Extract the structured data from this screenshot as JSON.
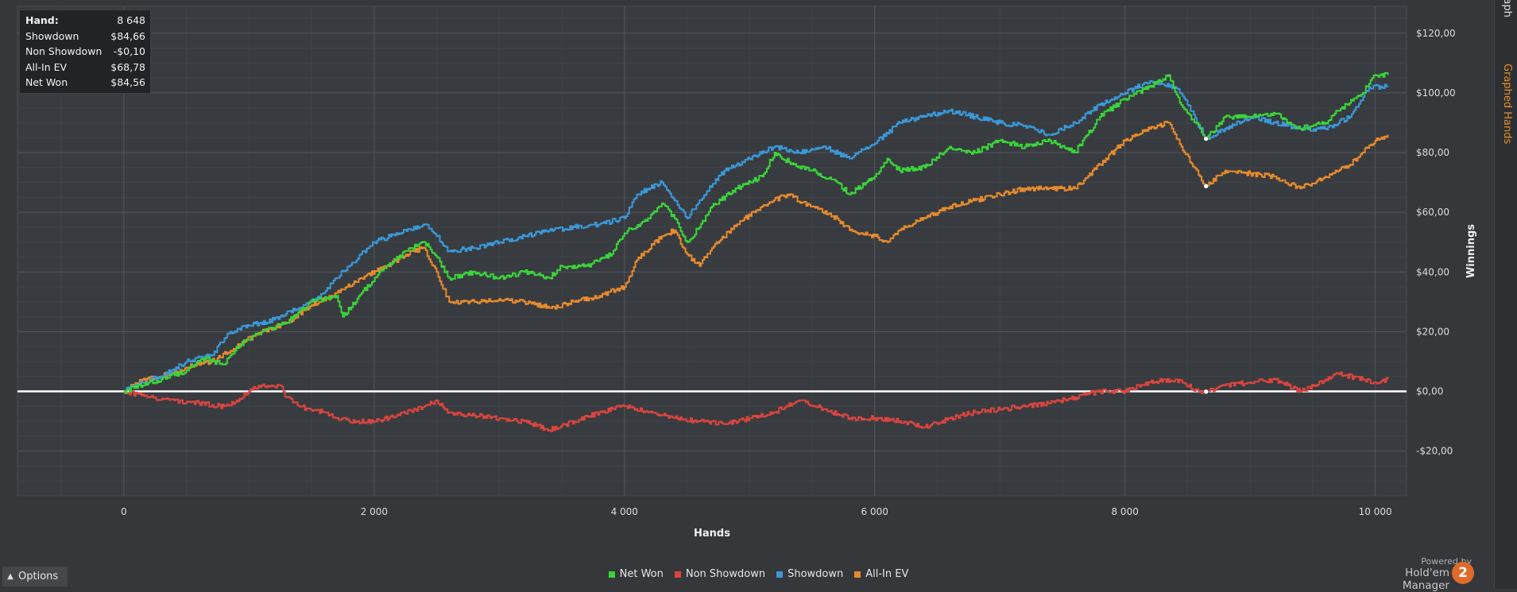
{
  "tooltip": {
    "rows": [
      {
        "label": "Hand:",
        "value": "8 648"
      },
      {
        "label": "Showdown",
        "value": "$84,66"
      },
      {
        "label": "Non Showdown",
        "value": "-$0,10"
      },
      {
        "label": "All-In EV",
        "value": "$68,78"
      },
      {
        "label": "Net Won",
        "value": "$84,56"
      }
    ]
  },
  "chart_data": {
    "type": "line",
    "xlabel": "Hands",
    "ylabel": "Winnings",
    "xlim": [
      -850,
      10250
    ],
    "ylim": [
      -35,
      129
    ],
    "x_ticks": [
      0,
      2000,
      4000,
      6000,
      8000,
      10000
    ],
    "x_tick_labels": [
      "0",
      "2 000",
      "4 000",
      "6 000",
      "8 000",
      "10 000"
    ],
    "y_ticks": [
      -20,
      0,
      20,
      40,
      60,
      80,
      100,
      120
    ],
    "y_tick_labels": [
      "-$20,00",
      "$0,00",
      "$20,00",
      "$40,00",
      "$60,00",
      "$80,00",
      "$100,00",
      "$120,00"
    ],
    "grid": true,
    "legend_position": "bottom",
    "series": [
      {
        "name": "Net Won",
        "color": "#3ad43a",
        "points": [
          [
            0,
            0
          ],
          [
            150,
            2
          ],
          [
            300,
            4
          ],
          [
            500,
            7
          ],
          [
            650,
            11
          ],
          [
            800,
            9
          ],
          [
            900,
            15
          ],
          [
            1100,
            20
          ],
          [
            1300,
            23
          ],
          [
            1500,
            30
          ],
          [
            1700,
            32
          ],
          [
            1750,
            25
          ],
          [
            1900,
            33
          ],
          [
            2100,
            42
          ],
          [
            2300,
            48
          ],
          [
            2400,
            50
          ],
          [
            2500,
            45
          ],
          [
            2600,
            38
          ],
          [
            2800,
            40
          ],
          [
            3000,
            38
          ],
          [
            3200,
            40
          ],
          [
            3400,
            38
          ],
          [
            3500,
            42
          ],
          [
            3700,
            42
          ],
          [
            3900,
            46
          ],
          [
            4000,
            53
          ],
          [
            4200,
            58
          ],
          [
            4300,
            63
          ],
          [
            4400,
            58
          ],
          [
            4500,
            50
          ],
          [
            4600,
            55
          ],
          [
            4700,
            62
          ],
          [
            4900,
            68
          ],
          [
            5100,
            72
          ],
          [
            5200,
            80
          ],
          [
            5350,
            76
          ],
          [
            5500,
            74
          ],
          [
            5700,
            70
          ],
          [
            5800,
            66
          ],
          [
            6000,
            72
          ],
          [
            6100,
            78
          ],
          [
            6200,
            74
          ],
          [
            6400,
            75
          ],
          [
            6600,
            82
          ],
          [
            6800,
            80
          ],
          [
            7000,
            84
          ],
          [
            7200,
            82
          ],
          [
            7400,
            84
          ],
          [
            7600,
            80
          ],
          [
            7700,
            86
          ],
          [
            7800,
            92
          ],
          [
            8000,
            98
          ],
          [
            8200,
            102
          ],
          [
            8350,
            106
          ],
          [
            8450,
            96
          ],
          [
            8600,
            88
          ],
          [
            8648,
            84.56
          ],
          [
            8800,
            92
          ],
          [
            9000,
            92
          ],
          [
            9200,
            93
          ],
          [
            9400,
            88
          ],
          [
            9600,
            90
          ],
          [
            9700,
            94
          ],
          [
            9900,
            100
          ],
          [
            10000,
            106
          ],
          [
            10100,
            106
          ]
        ]
      },
      {
        "name": "Non Showdown",
        "color": "#d9453f",
        "points": [
          [
            0,
            0
          ],
          [
            200,
            -2
          ],
          [
            400,
            -3
          ],
          [
            600,
            -4
          ],
          [
            800,
            -5
          ],
          [
            900,
            -3
          ],
          [
            1000,
            0
          ],
          [
            1100,
            2
          ],
          [
            1250,
            2
          ],
          [
            1300,
            -2
          ],
          [
            1400,
            -5
          ],
          [
            1600,
            -7
          ],
          [
            1800,
            -10
          ],
          [
            2000,
            -10
          ],
          [
            2200,
            -8
          ],
          [
            2400,
            -5
          ],
          [
            2500,
            -3
          ],
          [
            2600,
            -7
          ],
          [
            2800,
            -8
          ],
          [
            3000,
            -9
          ],
          [
            3200,
            -10
          ],
          [
            3400,
            -13
          ],
          [
            3600,
            -10
          ],
          [
            3800,
            -7
          ],
          [
            4000,
            -5
          ],
          [
            4200,
            -7
          ],
          [
            4400,
            -9
          ],
          [
            4600,
            -10
          ],
          [
            4800,
            -11
          ],
          [
            5000,
            -9
          ],
          [
            5200,
            -7
          ],
          [
            5400,
            -3
          ],
          [
            5600,
            -6
          ],
          [
            5800,
            -9
          ],
          [
            6000,
            -9
          ],
          [
            6200,
            -10
          ],
          [
            6400,
            -12
          ],
          [
            6600,
            -9
          ],
          [
            6800,
            -7
          ],
          [
            7000,
            -6
          ],
          [
            7200,
            -5
          ],
          [
            7400,
            -4
          ],
          [
            7600,
            -2
          ],
          [
            7800,
            0
          ],
          [
            8000,
            0
          ],
          [
            8200,
            3
          ],
          [
            8400,
            4
          ],
          [
            8600,
            0
          ],
          [
            8648,
            -0.1
          ],
          [
            8800,
            2
          ],
          [
            9000,
            3
          ],
          [
            9200,
            4
          ],
          [
            9300,
            2
          ],
          [
            9400,
            0
          ],
          [
            9600,
            4
          ],
          [
            9700,
            6
          ],
          [
            9900,
            4
          ],
          [
            10000,
            3
          ],
          [
            10100,
            4
          ]
        ]
      },
      {
        "name": "Showdown",
        "color": "#3a98d8",
        "points": [
          [
            0,
            0
          ],
          [
            150,
            3
          ],
          [
            300,
            5
          ],
          [
            500,
            10
          ],
          [
            700,
            12
          ],
          [
            850,
            20
          ],
          [
            1000,
            22
          ],
          [
            1200,
            24
          ],
          [
            1400,
            28
          ],
          [
            1600,
            33
          ],
          [
            1700,
            38
          ],
          [
            1800,
            42
          ],
          [
            2000,
            50
          ],
          [
            2200,
            53
          ],
          [
            2400,
            56
          ],
          [
            2500,
            52
          ],
          [
            2600,
            47
          ],
          [
            2800,
            48
          ],
          [
            3000,
            50
          ],
          [
            3200,
            52
          ],
          [
            3400,
            54
          ],
          [
            3600,
            55
          ],
          [
            3800,
            56
          ],
          [
            4000,
            58
          ],
          [
            4100,
            66
          ],
          [
            4300,
            70
          ],
          [
            4400,
            64
          ],
          [
            4500,
            58
          ],
          [
            4600,
            64
          ],
          [
            4800,
            74
          ],
          [
            5000,
            78
          ],
          [
            5200,
            82
          ],
          [
            5400,
            80
          ],
          [
            5600,
            82
          ],
          [
            5800,
            78
          ],
          [
            6000,
            83
          ],
          [
            6200,
            90
          ],
          [
            6400,
            92
          ],
          [
            6600,
            94
          ],
          [
            6800,
            92
          ],
          [
            7000,
            90
          ],
          [
            7200,
            89
          ],
          [
            7400,
            86
          ],
          [
            7600,
            90
          ],
          [
            7800,
            96
          ],
          [
            8000,
            100
          ],
          [
            8200,
            104
          ],
          [
            8400,
            102
          ],
          [
            8500,
            96
          ],
          [
            8648,
            84.66
          ],
          [
            8800,
            88
          ],
          [
            9000,
            92
          ],
          [
            9200,
            90
          ],
          [
            9400,
            88
          ],
          [
            9600,
            88
          ],
          [
            9800,
            92
          ],
          [
            9950,
            102
          ],
          [
            10100,
            102
          ]
        ]
      },
      {
        "name": "All-In EV",
        "color": "#e68a2e",
        "points": [
          [
            0,
            0
          ],
          [
            150,
            4
          ],
          [
            300,
            5
          ],
          [
            500,
            8
          ],
          [
            700,
            10
          ],
          [
            900,
            15
          ],
          [
            1100,
            20
          ],
          [
            1300,
            23
          ],
          [
            1500,
            29
          ],
          [
            1700,
            33
          ],
          [
            1900,
            38
          ],
          [
            2100,
            42
          ],
          [
            2300,
            47
          ],
          [
            2400,
            48
          ],
          [
            2500,
            40
          ],
          [
            2600,
            30
          ],
          [
            2800,
            30
          ],
          [
            3000,
            31
          ],
          [
            3200,
            30
          ],
          [
            3400,
            28
          ],
          [
            3600,
            30
          ],
          [
            3800,
            32
          ],
          [
            4000,
            35
          ],
          [
            4100,
            44
          ],
          [
            4300,
            52
          ],
          [
            4400,
            54
          ],
          [
            4500,
            46
          ],
          [
            4600,
            42
          ],
          [
            4700,
            48
          ],
          [
            4900,
            56
          ],
          [
            5100,
            62
          ],
          [
            5300,
            66
          ],
          [
            5500,
            62
          ],
          [
            5700,
            58
          ],
          [
            5800,
            54
          ],
          [
            6000,
            52
          ],
          [
            6100,
            50
          ],
          [
            6200,
            54
          ],
          [
            6400,
            58
          ],
          [
            6600,
            62
          ],
          [
            6800,
            64
          ],
          [
            7000,
            66
          ],
          [
            7200,
            68
          ],
          [
            7400,
            68
          ],
          [
            7600,
            68
          ],
          [
            7800,
            76
          ],
          [
            8000,
            84
          ],
          [
            8200,
            88
          ],
          [
            8350,
            90
          ],
          [
            8450,
            82
          ],
          [
            8600,
            72
          ],
          [
            8648,
            68.78
          ],
          [
            8800,
            74
          ],
          [
            9000,
            73
          ],
          [
            9200,
            72
          ],
          [
            9400,
            68
          ],
          [
            9600,
            72
          ],
          [
            9800,
            76
          ],
          [
            10000,
            84
          ],
          [
            10100,
            86
          ]
        ]
      }
    ],
    "highlight_x": 8648
  },
  "legend": [
    {
      "label": "Net Won",
      "color": "#3ad43a"
    },
    {
      "label": "Non Showdown",
      "color": "#d9453f"
    },
    {
      "label": "Showdown",
      "color": "#3a98d8"
    },
    {
      "label": "All-In EV",
      "color": "#e68a2e"
    }
  ],
  "options": {
    "label": "Options",
    "icon": "chevron-up-icon"
  },
  "brand": {
    "small": "Powered by",
    "main": "Hold'em Manager",
    "badge": "2"
  },
  "side_tabs": {
    "tab1": "Graph",
    "tab2": "Graphed Hands"
  }
}
